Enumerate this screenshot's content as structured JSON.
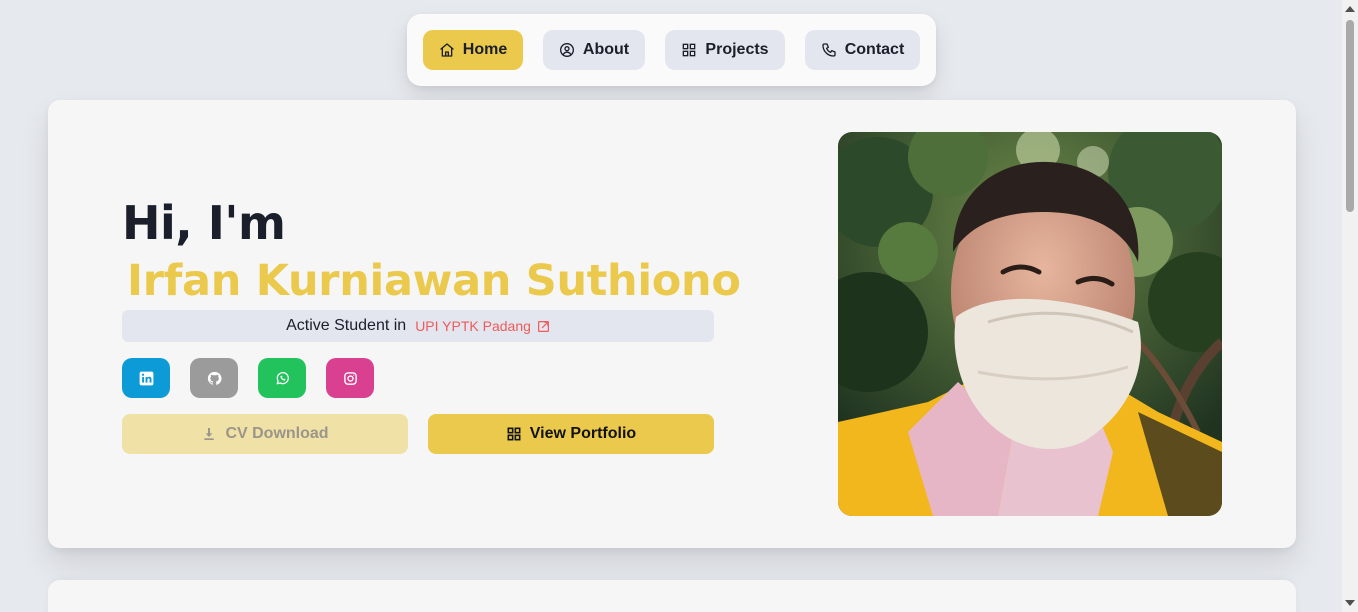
{
  "nav": {
    "items": [
      {
        "label": "Home",
        "icon": "home-icon",
        "active": true
      },
      {
        "label": "About",
        "icon": "user-circle-icon",
        "active": false
      },
      {
        "label": "Projects",
        "icon": "grid-icon",
        "active": false
      },
      {
        "label": "Contact",
        "icon": "phone-icon",
        "active": false
      }
    ]
  },
  "hero": {
    "greeting": "Hi, I'm",
    "name": "Irfan Kurniawan Suthiono",
    "status_prefix": "Active Student in",
    "institution": "UPI YPTK Padang",
    "socials": [
      {
        "network": "LinkedIn",
        "icon": "linkedin-icon",
        "color": "#0d9bd8"
      },
      {
        "network": "GitHub",
        "icon": "github-icon",
        "color": "#9b9b9b"
      },
      {
        "network": "WhatsApp",
        "icon": "whatsapp-icon",
        "color": "#22c25c"
      },
      {
        "network": "Instagram",
        "icon": "instagram-icon",
        "color": "#d9408f"
      }
    ],
    "cv_label": "CV Download",
    "portfolio_label": "View Portfolio",
    "photo_icon": "profile-photo"
  },
  "colors": {
    "accent": "#eac94c",
    "accent_light": "#f0e1a6",
    "nav_button": "#e3e6ee",
    "link": "#ee5b5b",
    "background": "#e6e9ee",
    "card": "#f6f6f6"
  }
}
